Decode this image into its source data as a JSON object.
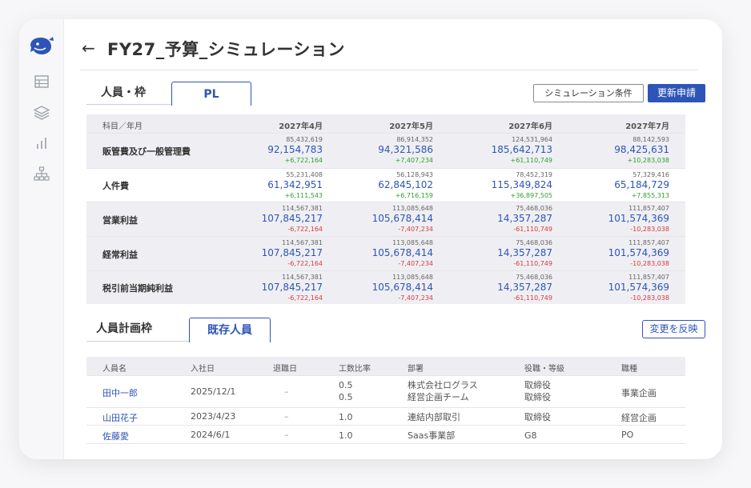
{
  "page": {
    "title": "FY27_予算_シミュレーション",
    "back_icon": "arrow-left-icon"
  },
  "sidebar": {
    "items": [
      {
        "icon": "whale-logo-icon"
      },
      {
        "icon": "table-icon"
      },
      {
        "icon": "layers-icon"
      },
      {
        "icon": "bar-chart-icon"
      },
      {
        "icon": "org-chart-icon"
      }
    ]
  },
  "pl_section": {
    "tabs": [
      "人員・枠",
      "PL"
    ],
    "active_tab": "PL",
    "sim_conditions_label": "シミュレーション条件",
    "update_request_label": "更新申請",
    "header": {
      "label_col": "科目／年月",
      "months": [
        "2027年4月",
        "2027年5月",
        "2027年6月",
        "2027年7月"
      ]
    },
    "rows": [
      {
        "label": "販管費及び一般管理費",
        "shaded": true,
        "cells": [
          {
            "prev": "85,432,619",
            "main": "92,154,783",
            "diff": "+6,722,164",
            "sign": "pos"
          },
          {
            "prev": "86,914,352",
            "main": "94,321,586",
            "diff": "+7,407,234",
            "sign": "pos"
          },
          {
            "prev": "124,531,964",
            "main": "185,642,713",
            "diff": "+61,110,749",
            "sign": "pos"
          },
          {
            "prev": "88,142,593",
            "main": "98,425,631",
            "diff": "+10,283,038",
            "sign": "pos"
          }
        ]
      },
      {
        "label": "人件費",
        "shaded": false,
        "cells": [
          {
            "prev": "55,231,408",
            "main": "61,342,951",
            "diff": "+6,111,543",
            "sign": "pos"
          },
          {
            "prev": "56,128,943",
            "main": "62,845,102",
            "diff": "+6,716,159",
            "sign": "pos"
          },
          {
            "prev": "78,452,319",
            "main": "115,349,824",
            "diff": "+36,897,505",
            "sign": "pos"
          },
          {
            "prev": "57,329,416",
            "main": "65,184,729",
            "diff": "+7,855,313",
            "sign": "pos"
          }
        ]
      },
      {
        "label": "営業利益",
        "shaded": true,
        "cells": [
          {
            "prev": "114,567,381",
            "main": "107,845,217",
            "diff": "-6,722,164",
            "sign": "neg"
          },
          {
            "prev": "113,085,648",
            "main": "105,678,414",
            "diff": "-7,407,234",
            "sign": "neg"
          },
          {
            "prev": "75,468,036",
            "main": "14,357,287",
            "diff": "-61,110,749",
            "sign": "neg"
          },
          {
            "prev": "111,857,407",
            "main": "101,574,369",
            "diff": "-10,283,038",
            "sign": "neg"
          }
        ]
      },
      {
        "label": "経常利益",
        "shaded": true,
        "cells": [
          {
            "prev": "114,567,381",
            "main": "107,845,217",
            "diff": "-6,722,164",
            "sign": "neg"
          },
          {
            "prev": "113,085,648",
            "main": "105,678,414",
            "diff": "-7,407,234",
            "sign": "neg"
          },
          {
            "prev": "75,468,036",
            "main": "14,357,287",
            "diff": "-61,110,749",
            "sign": "neg"
          },
          {
            "prev": "111,857,407",
            "main": "101,574,369",
            "diff": "-10,283,038",
            "sign": "neg"
          }
        ]
      },
      {
        "label": "税引前当期純利益",
        "shaded": true,
        "cells": [
          {
            "prev": "114,567,381",
            "main": "107,845,217",
            "diff": "-6,722,164",
            "sign": "neg"
          },
          {
            "prev": "113,085,648",
            "main": "105,678,414",
            "diff": "-7,407,234",
            "sign": "neg"
          },
          {
            "prev": "75,468,036",
            "main": "14,357,287",
            "diff": "-61,110,749",
            "sign": "neg"
          },
          {
            "prev": "111,857,407",
            "main": "101,574,369",
            "diff": "-10,283,038",
            "sign": "neg"
          }
        ]
      }
    ]
  },
  "staff_section": {
    "tabs": [
      "人員計画枠",
      "既存人員"
    ],
    "active_tab": "既存人員",
    "reflect_label": "変更を反映",
    "columns": [
      "人員名",
      "入社日",
      "退職日",
      "工数比率",
      "部署",
      "役職・等級",
      "職種"
    ],
    "rows": [
      {
        "name": "田中一郎",
        "hire": "2025/12/1",
        "retire": "–",
        "ratio": [
          "0.5",
          "0.5"
        ],
        "dept": [
          "株式会社ログラス",
          "経営企画チーム"
        ],
        "grade": [
          "取締役",
          "取締役"
        ],
        "job": "事業企画"
      },
      {
        "name": "山田花子",
        "hire": "2023/4/23",
        "retire": "–",
        "ratio": [
          "1.0"
        ],
        "dept": [
          "連結内部取引"
        ],
        "grade": [
          "取締役"
        ],
        "job": "経営企画"
      },
      {
        "name": "佐藤愛",
        "hire": "2024/6/1",
        "retire": "–",
        "ratio": [
          "1.0"
        ],
        "dept": [
          "Saas事業部"
        ],
        "grade": [
          "G8"
        ],
        "job": "PO"
      }
    ]
  },
  "colors": {
    "accent": "#2d55b8",
    "positive": "#2f9e2f",
    "negative": "#d93a3a",
    "row_shade": "#efeff3"
  }
}
